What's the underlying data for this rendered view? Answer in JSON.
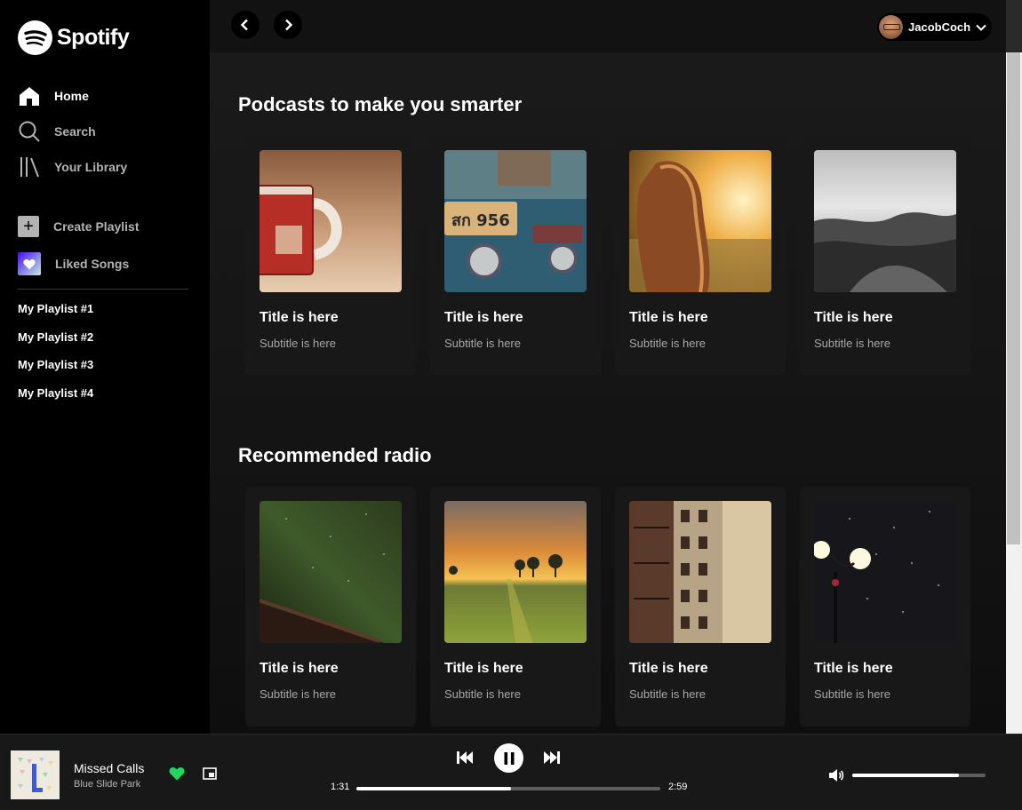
{
  "app": {
    "name": "Spotify",
    "accent": "#1ed760"
  },
  "nav": {
    "home": "Home",
    "search": "Search",
    "library": "Your Library"
  },
  "actions": {
    "create_playlist": "Create Playlist",
    "liked_songs": "Liked Songs"
  },
  "playlists": [
    "My Playlist #1",
    "My Playlist #2",
    "My Playlist #3",
    "My Playlist #4"
  ],
  "header": {
    "user": "JacobCoch"
  },
  "sections": [
    {
      "title": "Podcasts to make you smarter",
      "cards": [
        {
          "title": "Title is here",
          "subtitle": "Subtitle is here",
          "image": "mug-photo"
        },
        {
          "title": "Title is here",
          "subtitle": "Subtitle is here",
          "image": "tuk-tuk-license-plate-photo"
        },
        {
          "title": "Title is here",
          "subtitle": "Subtitle is here",
          "image": "girl-in-sunset-field-photo"
        },
        {
          "title": "Title is here",
          "subtitle": "Subtitle is here",
          "image": "mountain-valley-bw-photo"
        }
      ]
    },
    {
      "title": "Recommended radio",
      "cards": [
        {
          "title": "Title is here",
          "subtitle": "Subtitle is here",
          "image": "night-sky-fence-photo"
        },
        {
          "title": "Title is here",
          "subtitle": "Subtitle is here",
          "image": "sunset-meadow-trees-photo"
        },
        {
          "title": "Title is here",
          "subtitle": "Subtitle is here",
          "image": "old-building-facade-photo"
        },
        {
          "title": "Title is here",
          "subtitle": "Subtitle is here",
          "image": "street-lamps-in-snow-photo"
        }
      ]
    }
  ],
  "player": {
    "track": "Missed Calls",
    "artist": "Blue Slide Park",
    "current_time": "1:31",
    "total_time": "2:59",
    "progress_fraction": 0.51,
    "volume_fraction": 0.8,
    "liked": true
  }
}
